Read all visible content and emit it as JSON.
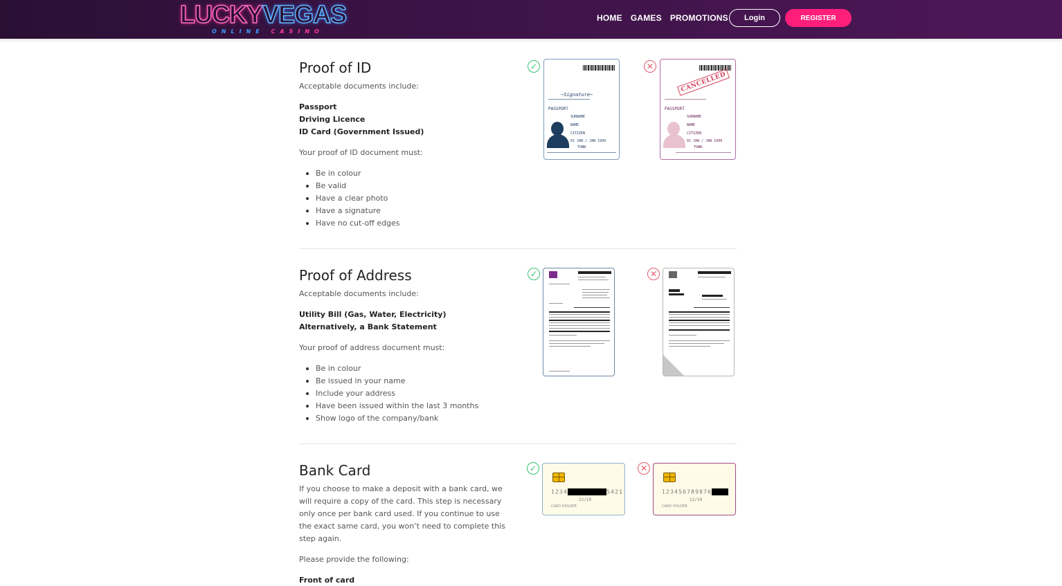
{
  "header": {
    "logo_main_1": "LUCKY",
    "logo_main_2": "VEGAS",
    "logo_sub_1": "ONLINE",
    "logo_sub_2": "CASINO",
    "nav": [
      "HOME",
      "GAMES",
      "PROMOTIONS"
    ],
    "login_label": "Login",
    "register_label": "REGISTER"
  },
  "proof_of_id": {
    "title": "Proof of ID",
    "intro": "Acceptable documents include:",
    "documents": [
      "Passport",
      "Driving Licence",
      "ID Card (Government Issued)"
    ],
    "must_intro": "Your proof of ID document must:",
    "requirements": [
      "Be in colour",
      "Be valid",
      "Have a clear photo",
      "Have a signature",
      "Have no cut-off edges"
    ],
    "card_label": "PASSPORT",
    "card_surname": "SURNAME",
    "card_name": "NAME",
    "card_nationality": "CITIZEN",
    "card_dob": "01 JAN / JAN 1999",
    "card_pob": "TOWN",
    "cancelled_stamp": "CANCELLED"
  },
  "proof_of_address": {
    "title": "Proof of Address",
    "intro": "Acceptable documents include:",
    "documents": [
      "Utility Bill (Gas, Water, Electricity)",
      "Alternatively, a Bank Statement"
    ],
    "must_intro": "Your proof of address document must:",
    "requirements": [
      "Be in colour",
      "Be issued in your name",
      "Include your address",
      "Have been issued within the last 3 months",
      "Show logo of the company/bank"
    ]
  },
  "bank_card": {
    "title": "Bank Card",
    "description": "If you choose to make a deposit with a bank card, we will require a copy of the card. This step is necessary only once per bank card used. If you continue to use the exact same card, you won’t need to complete this step again.",
    "provide_intro": "Please provide the following:",
    "first_item": "Front of card",
    "good_card_start": "1234",
    "good_card_end": "5421",
    "bad_card_number": "123456789876",
    "expiry": "12/19",
    "holder": "CARD HOLDER"
  },
  "icons": {
    "ok": "check-circle-icon",
    "bad": "cross-circle-icon"
  },
  "colors": {
    "header_bg": "#3c1346",
    "register_bg": "#ff1f7a",
    "ok": "#37c26b",
    "bad": "#e35a6a"
  }
}
